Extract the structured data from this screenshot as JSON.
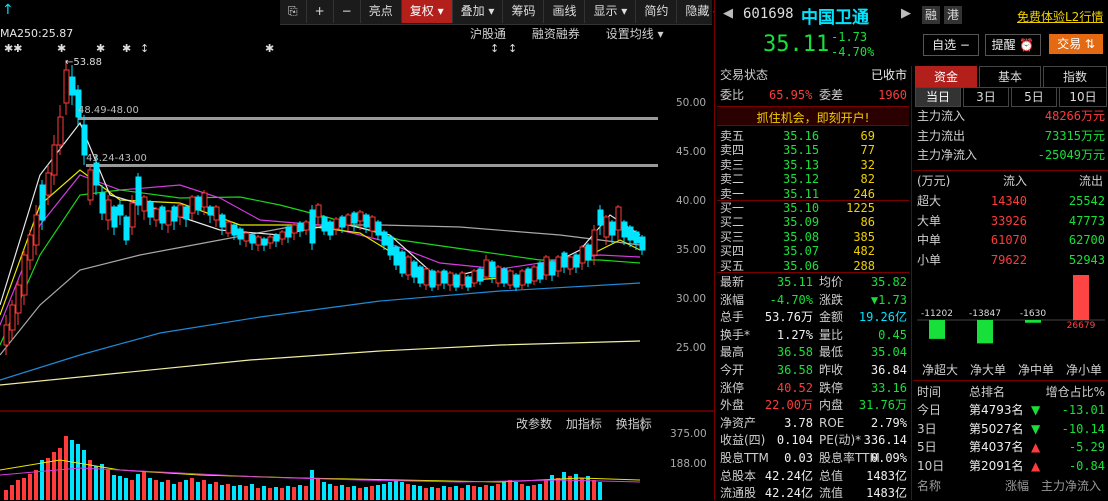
{
  "toolbar": {
    "items": [
      "⎘",
      "+",
      "−",
      "亮点",
      "复权 ▾",
      "叠加 ▾",
      "筹码",
      "画线",
      "显示 ▾",
      "简约",
      "隐藏 ◂▸"
    ]
  },
  "chart_menu": {
    "items": [
      "沪股通",
      "融资融券",
      "设置均线 ▾"
    ]
  },
  "ma_label": "MA250:25.87",
  "arrow_marks": [
    "↑",
    "✱✱",
    "✱",
    "✱",
    "✱",
    "↕",
    "✱",
    "↕",
    "↕"
  ],
  "annotations": {
    "high": "←53.88",
    "line1": "48.49-48.00",
    "line2": "43.24-43.00"
  },
  "price_axis": [
    "50.00",
    "45.00",
    "40.00",
    "35.00",
    "30.00",
    "25.00"
  ],
  "indicator_menu": {
    "items": [
      "改参数",
      "加指标",
      "换指标"
    ]
  },
  "volume_axis": [
    "375.00",
    "188.00"
  ],
  "stock": {
    "code": "601698",
    "name": "中国卫通",
    "tags": [
      "融",
      "港"
    ],
    "l2_link": "免费体验L2行情",
    "price": "35.11",
    "change": "-1.73",
    "change_pct": "-4.70%",
    "btn_select": "自选 −",
    "btn_remind": "提醒 ⏰",
    "btn_trade": "交易 ⇅"
  },
  "trade_status": {
    "label": "交易状态",
    "value": "已收市"
  },
  "ratio": {
    "l1": "委比",
    "v1": "65.95%",
    "l2": "委差",
    "v2": "1960"
  },
  "promo": "抓住机会，即刻开户!",
  "asks": [
    {
      "label": "卖五",
      "price": "35.16",
      "vol": "69"
    },
    {
      "label": "卖四",
      "price": "35.15",
      "vol": "77"
    },
    {
      "label": "卖三",
      "price": "35.13",
      "vol": "32"
    },
    {
      "label": "卖二",
      "price": "35.12",
      "vol": "82"
    },
    {
      "label": "卖一",
      "price": "35.11",
      "vol": "246"
    }
  ],
  "bids": [
    {
      "label": "买一",
      "price": "35.10",
      "vol": "1225"
    },
    {
      "label": "买二",
      "price": "35.09",
      "vol": "86"
    },
    {
      "label": "买三",
      "price": "35.08",
      "vol": "385"
    },
    {
      "label": "买四",
      "price": "35.07",
      "vol": "482"
    },
    {
      "label": "买五",
      "price": "35.06",
      "vol": "288"
    }
  ],
  "stats": [
    {
      "l1": "最新",
      "v1": "35.11",
      "c1": "green",
      "l2": "均价",
      "v2": "35.82",
      "c2": "green"
    },
    {
      "l1": "涨幅",
      "v1": "-4.70%",
      "c1": "green",
      "l2": "涨跌",
      "v2": "▼1.73",
      "c2": "green"
    },
    {
      "l1": "总手",
      "v1": "53.76万",
      "c1": "white",
      "l2": "金额",
      "v2": "19.26亿",
      "c2": "cyan"
    },
    {
      "l1": "换手*",
      "v1": "1.27%",
      "c1": "white",
      "l2": "量比",
      "v2": "0.45",
      "c2": "green"
    },
    {
      "l1": "最高",
      "v1": "36.58",
      "c1": "green",
      "l2": "最低",
      "v2": "35.04",
      "c2": "green"
    },
    {
      "l1": "今开",
      "v1": "36.58",
      "c1": "green",
      "l2": "昨收",
      "v2": "36.84",
      "c2": "white"
    },
    {
      "l1": "涨停",
      "v1": "40.52",
      "c1": "red",
      "l2": "跌停",
      "v2": "33.16",
      "c2": "green"
    },
    {
      "l1": "外盘",
      "v1": "22.00万",
      "c1": "red",
      "l2": "内盘",
      "v2": "31.76万",
      "c2": "green"
    },
    {
      "l1": "净资产",
      "v1": "3.78",
      "c1": "white",
      "l2": "ROE",
      "v2": "2.79%",
      "c2": "white"
    },
    {
      "l1": "收益(四)",
      "v1": "0.104",
      "c1": "white",
      "l2": "PE(动)*",
      "v2": "336.14",
      "c2": "white"
    },
    {
      "l1": "股息TTM",
      "v1": "0.03",
      "c1": "white",
      "l2": "股息率TTM",
      "v2": "0.09%",
      "c2": "white"
    },
    {
      "l1": "总股本",
      "v1": "42.24亿",
      "c1": "white",
      "l2": "总值",
      "v2": "1483亿",
      "c2": "white"
    },
    {
      "l1": "流通股",
      "v1": "42.24亿",
      "c1": "white",
      "l2": "流值",
      "v2": "1483亿",
      "c2": "white"
    }
  ],
  "fund_tabs": [
    "资金",
    "基本",
    "指数"
  ],
  "period_tabs": [
    "当日",
    "3日",
    "5日",
    "10日"
  ],
  "main_flow": [
    {
      "label": "主力流入",
      "value": "48266万元",
      "color": "red"
    },
    {
      "label": "主力流出",
      "value": "73315万元",
      "color": "green"
    },
    {
      "label": "主力净流入",
      "value": "-25049万元",
      "color": "green"
    }
  ],
  "flow_table": {
    "headers": [
      "(万元)",
      "流入",
      "流出"
    ],
    "rows": [
      {
        "label": "超大",
        "in": "14340",
        "out": "25542"
      },
      {
        "label": "大单",
        "in": "33926",
        "out": "47773"
      },
      {
        "label": "中单",
        "in": "61070",
        "out": "62700"
      },
      {
        "label": "小单",
        "in": "79622",
        "out": "52943"
      }
    ]
  },
  "net_flow_chart": {
    "bars": [
      {
        "label": "净超大",
        "value": -11202
      },
      {
        "label": "净大单",
        "value": -13847
      },
      {
        "label": "净中单",
        "value": -1630
      },
      {
        "label": "净小单",
        "value": 26679
      }
    ],
    "value_texts": [
      "-11202",
      "-13847",
      "-1630",
      "26679"
    ]
  },
  "rank_table": {
    "headers": [
      "时间",
      "总排名",
      "增仓占比%"
    ],
    "rows": [
      {
        "t": "今日",
        "rank": "第4793名",
        "dir": "down",
        "pct": "-13.01"
      },
      {
        "t": "3日",
        "rank": "第5027名",
        "dir": "down",
        "pct": "-10.14"
      },
      {
        "t": "5日",
        "rank": "第4037名",
        "dir": "up",
        "pct": "-5.29"
      },
      {
        "t": "10日",
        "rank": "第2091名",
        "dir": "up",
        "pct": "-0.84"
      }
    ],
    "footer": [
      "名称",
      "涨幅",
      "主力净流入"
    ]
  },
  "colors": {
    "up": "#ff3b3b",
    "down": "#00e5ff",
    "accent": "#b3201c",
    "bg": "#000000"
  }
}
